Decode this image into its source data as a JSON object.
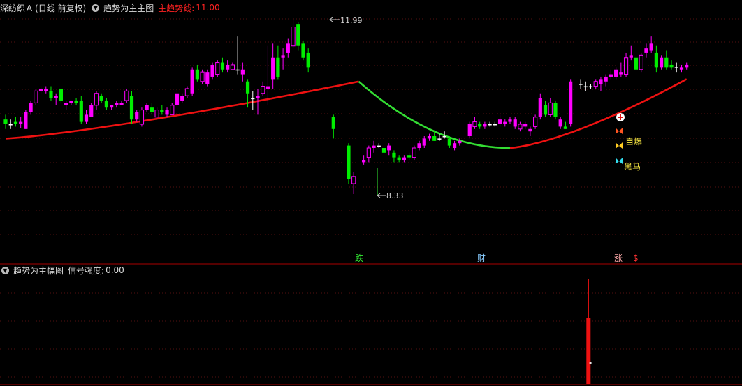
{
  "main_header": {
    "stock_name": "深纺织Ａ",
    "period": "(日线 前复权)",
    "indicator_name": "趋势为主主图",
    "trend_line_label": "主趋势线:",
    "trend_line_value": "11.00"
  },
  "sub_header": {
    "indicator_name": "趋势为主幅图",
    "signal_label": "信号强度:",
    "signal_value": "0.00"
  },
  "annotations": {
    "high_label": "11.99",
    "low_label": "8.33",
    "signal_zibao": "自爆",
    "signal_heima": "黑马",
    "marker_die": "跌",
    "marker_cai": "财",
    "marker_zhang": "涨",
    "marker_dollar": "$"
  },
  "colors": {
    "up": "#ff00ff",
    "down": "#00ee00",
    "flat": "#ffffff",
    "trend_up": "#ee1111",
    "trend_down": "#33dd33",
    "grid": "#551111",
    "separator": "#aa0000"
  },
  "chart_data": {
    "type": "candlestick",
    "ohlc": [
      [
        9.9,
        10.0,
        9.7,
        9.8
      ],
      [
        9.8,
        9.9,
        9.7,
        9.8
      ],
      [
        9.85,
        9.95,
        9.75,
        9.8
      ],
      [
        9.8,
        9.95,
        9.72,
        9.85
      ],
      [
        9.7,
        10.1,
        9.7,
        10.05
      ],
      [
        10.05,
        10.3,
        10.0,
        10.25
      ],
      [
        10.25,
        10.55,
        10.2,
        10.5
      ],
      [
        10.5,
        10.6,
        10.45,
        10.55
      ],
      [
        10.5,
        10.6,
        10.45,
        10.55
      ],
      [
        10.5,
        10.6,
        10.3,
        10.35
      ],
      [
        10.35,
        10.45,
        10.2,
        10.4
      ],
      [
        10.55,
        10.55,
        10.25,
        10.3
      ],
      [
        10.2,
        10.3,
        10.1,
        10.25
      ],
      [
        10.25,
        10.3,
        10.2,
        10.3
      ],
      [
        10.3,
        10.35,
        10.2,
        10.25
      ],
      [
        10.3,
        10.4,
        9.8,
        9.85
      ],
      [
        9.85,
        10.1,
        9.8,
        10.0
      ],
      [
        9.95,
        10.25,
        9.95,
        10.2
      ],
      [
        10.2,
        10.5,
        10.1,
        10.45
      ],
      [
        10.4,
        10.45,
        10.25,
        10.3
      ],
      [
        10.3,
        10.35,
        10.1,
        10.15
      ],
      [
        10.15,
        10.2,
        10.1,
        10.2
      ],
      [
        10.2,
        10.3,
        10.15,
        10.25
      ],
      [
        10.2,
        10.3,
        10.2,
        10.25
      ],
      [
        10.3,
        10.55,
        10.25,
        10.5
      ],
      [
        10.4,
        10.5,
        9.8,
        9.9
      ],
      [
        9.9,
        10.1,
        9.85,
        10.05
      ],
      [
        9.8,
        10.15,
        9.75,
        10.1
      ],
      [
        10.1,
        10.25,
        10.05,
        10.2
      ],
      [
        10.15,
        10.25,
        10.0,
        10.05
      ],
      [
        9.95,
        10.15,
        9.95,
        10.1
      ],
      [
        10.1,
        10.2,
        10.0,
        10.05
      ],
      [
        10.0,
        10.15,
        9.95,
        10.1
      ],
      [
        10.0,
        10.25,
        10.0,
        10.2
      ],
      [
        10.2,
        10.55,
        10.15,
        10.45
      ],
      [
        10.3,
        10.45,
        10.25,
        10.4
      ],
      [
        10.4,
        10.6,
        10.35,
        10.55
      ],
      [
        10.45,
        11.0,
        10.4,
        10.95
      ],
      [
        10.95,
        11.05,
        10.7,
        10.75
      ],
      [
        10.7,
        10.95,
        10.65,
        10.9
      ],
      [
        10.65,
        10.95,
        10.6,
        10.9
      ],
      [
        10.8,
        11.1,
        10.75,
        11.05
      ],
      [
        10.85,
        11.15,
        10.8,
        11.1
      ],
      [
        11.1,
        11.2,
        10.9,
        10.95
      ],
      [
        10.95,
        11.15,
        10.9,
        11.05
      ],
      [
        10.95,
        11.1,
        10.95,
        11.05
      ],
      [
        10.95,
        11.65,
        10.85,
        10.95
      ],
      [
        10.85,
        11.1,
        10.7,
        10.95
      ],
      [
        10.7,
        10.75,
        10.15,
        10.45
      ],
      [
        10.35,
        10.5,
        10.1,
        10.35
      ],
      [
        10.35,
        10.55,
        10.0,
        10.4
      ],
      [
        10.45,
        10.7,
        10.4,
        10.6
      ],
      [
        10.55,
        11.45,
        10.2,
        10.6
      ],
      [
        10.75,
        11.5,
        10.55,
        11.2
      ],
      [
        11.2,
        11.45,
        10.75,
        10.8
      ],
      [
        11.2,
        11.4,
        10.95,
        11.25
      ],
      [
        11.3,
        11.6,
        11.2,
        11.5
      ],
      [
        11.45,
        11.99,
        11.4,
        11.85
      ],
      [
        11.9,
        11.95,
        11.35,
        11.45
      ],
      [
        11.5,
        11.55,
        11.15,
        11.2
      ],
      [
        11.3,
        11.4,
        10.9,
        11.0
      ],
      [
        null,
        null,
        null,
        null
      ],
      [
        null,
        null,
        null,
        null
      ],
      [
        null,
        null,
        null,
        null
      ],
      [
        null,
        null,
        null,
        null
      ],
      [
        9.95,
        10.0,
        9.5,
        9.7
      ],
      [
        null,
        null,
        null,
        null
      ],
      [
        null,
        null,
        null,
        null
      ],
      [
        9.35,
        9.4,
        8.55,
        8.65
      ],
      [
        8.55,
        8.8,
        8.33,
        8.7
      ],
      [
        null,
        null,
        null,
        null
      ],
      [
        9.0,
        9.15,
        8.95,
        9.05
      ],
      [
        9.1,
        9.35,
        9.0,
        9.3
      ],
      [
        9.3,
        9.45,
        9.2,
        9.35
      ],
      [
        9.35,
        9.4,
        9.3,
        9.35
      ],
      [
        9.3,
        9.35,
        9.15,
        9.2
      ],
      [
        9.25,
        9.4,
        9.15,
        9.35
      ],
      [
        9.2,
        9.25,
        9.0,
        9.1
      ],
      [
        9.1,
        9.15,
        9.0,
        9.05
      ],
      [
        9.05,
        9.15,
        9.0,
        9.1
      ],
      [
        9.15,
        9.2,
        9.05,
        9.1
      ],
      [
        9.1,
        9.35,
        9.05,
        9.3
      ],
      [
        9.3,
        9.45,
        9.25,
        9.4
      ],
      [
        9.35,
        9.55,
        9.3,
        9.5
      ],
      [
        9.5,
        9.6,
        9.45,
        9.55
      ],
      [
        9.55,
        9.65,
        9.45,
        9.45
      ],
      [
        9.5,
        9.6,
        9.45,
        9.5
      ],
      [
        9.55,
        9.65,
        9.5,
        9.55
      ],
      [
        9.5,
        9.55,
        9.3,
        9.35
      ],
      [
        9.3,
        9.45,
        9.25,
        9.4
      ],
      [
        9.4,
        9.5,
        9.35,
        9.45
      ],
      [
        null,
        null,
        null,
        null
      ],
      [
        9.55,
        9.85,
        9.5,
        9.8
      ],
      [
        9.75,
        9.95,
        9.7,
        9.85
      ],
      [
        9.8,
        9.85,
        9.7,
        9.75
      ],
      [
        9.75,
        9.85,
        9.7,
        9.8
      ],
      [
        9.8,
        9.85,
        9.75,
        9.8
      ],
      [
        9.8,
        9.85,
        9.75,
        9.8
      ],
      [
        9.8,
        10.0,
        9.75,
        9.9
      ],
      [
        9.8,
        9.9,
        9.75,
        9.85
      ],
      [
        9.85,
        9.95,
        9.8,
        9.9
      ],
      [
        9.75,
        9.95,
        9.7,
        9.9
      ],
      [
        9.7,
        9.85,
        9.65,
        9.8
      ],
      [
        9.75,
        9.85,
        9.7,
        9.8
      ],
      [
        9.65,
        9.75,
        9.55,
        9.7
      ],
      [
        9.75,
        10.0,
        9.7,
        9.95
      ],
      [
        9.95,
        10.45,
        9.9,
        10.35
      ],
      [
        10.2,
        10.3,
        9.95,
        10.0
      ],
      [
        10.0,
        10.35,
        9.95,
        10.25
      ],
      [
        10.25,
        10.3,
        9.9,
        9.95
      ],
      [
        9.75,
        9.95,
        9.7,
        9.9
      ],
      [
        9.75,
        9.85,
        9.7,
        9.7
      ],
      [
        9.8,
        10.75,
        9.75,
        10.7
      ],
      [
        null,
        null,
        null,
        null
      ],
      [
        10.65,
        10.75,
        10.55,
        10.65
      ],
      [
        10.6,
        10.7,
        10.5,
        10.6
      ],
      [
        10.6,
        10.65,
        10.55,
        10.6
      ],
      [
        10.6,
        10.75,
        10.55,
        10.7
      ],
      [
        10.65,
        10.8,
        10.5,
        10.75
      ],
      [
        10.7,
        10.85,
        10.6,
        10.8
      ],
      [
        10.8,
        10.95,
        10.75,
        10.85
      ],
      [
        10.8,
        11.0,
        10.75,
        10.95
      ],
      [
        10.85,
        11.1,
        10.8,
        10.9
      ],
      [
        10.85,
        11.3,
        10.8,
        11.2
      ],
      [
        11.2,
        11.45,
        11.15,
        11.25
      ],
      [
        11.2,
        11.35,
        10.9,
        10.95
      ],
      [
        10.95,
        11.3,
        10.9,
        11.25
      ],
      [
        11.3,
        11.5,
        11.2,
        11.4
      ],
      [
        11.35,
        11.65,
        11.3,
        11.5
      ],
      [
        11.3,
        11.45,
        10.9,
        11.0
      ],
      [
        11.0,
        11.25,
        10.95,
        11.2
      ],
      [
        11.2,
        11.35,
        10.95,
        11.0
      ],
      [
        11.05,
        11.15,
        10.95,
        11.0
      ],
      [
        11.0,
        11.1,
        10.9,
        11.0
      ],
      [
        10.95,
        11.05,
        10.9,
        11.0
      ],
      [
        11.0,
        11.1,
        10.95,
        11.05
      ]
    ],
    "trend_line": {
      "min": 9.5,
      "peak": 10.7,
      "trough": 9.3,
      "end": 10.75
    },
    "signal_bar": {
      "index": 115,
      "value": 0.0
    }
  }
}
